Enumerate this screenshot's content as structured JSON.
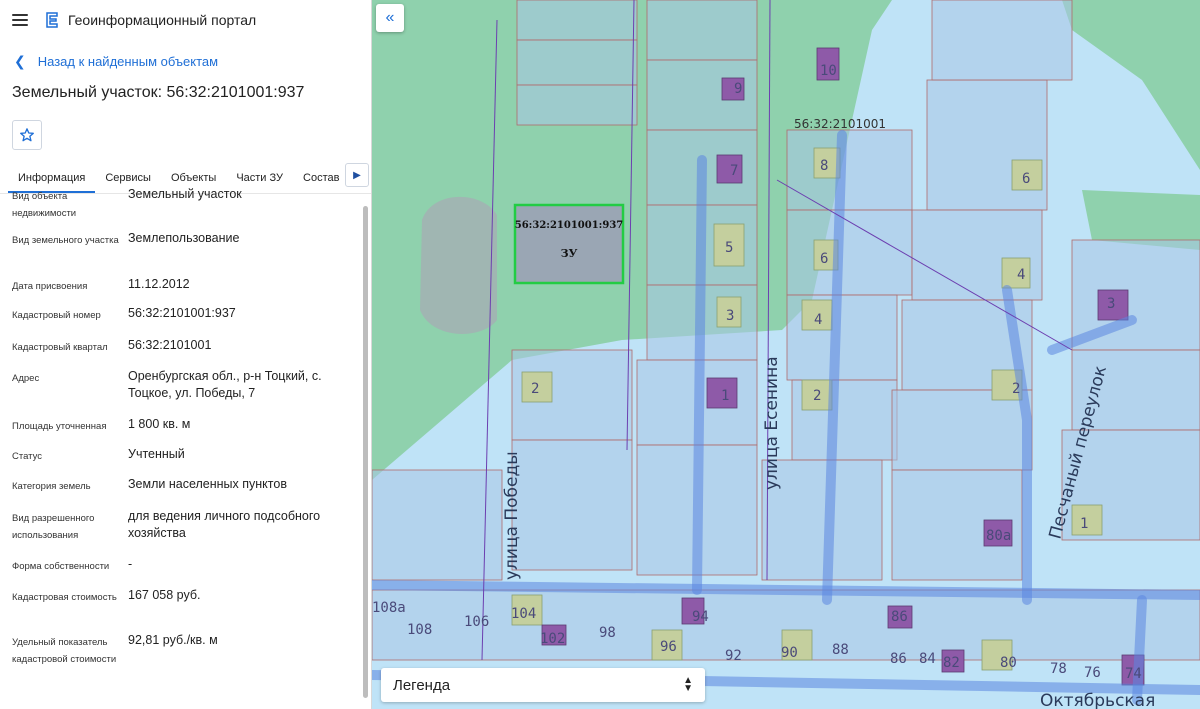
{
  "app": {
    "title": "Геоинформационный портал"
  },
  "nav": {
    "back_label": "Назад к найденным объектам"
  },
  "object": {
    "title": "Земельный участок: 56:32:2101001:937"
  },
  "tabs": [
    {
      "label": "Информация",
      "active": true
    },
    {
      "label": "Сервисы",
      "active": false
    },
    {
      "label": "Объекты",
      "active": false
    },
    {
      "label": "Части ЗУ",
      "active": false
    },
    {
      "label": "Состав",
      "active": false
    }
  ],
  "properties": [
    {
      "label": "Вид объекта недвижимости",
      "value": "Земельный участок"
    },
    {
      "label": "Вид земельного участка",
      "value": "Землепользование"
    },
    {
      "label": "Дата присвоения",
      "value": "11.12.2012"
    },
    {
      "label": "Кадастровый номер",
      "value": "56:32:2101001:937"
    },
    {
      "label": "Кадастровый квартал",
      "value": "56:32:2101001"
    },
    {
      "label": "Адрес",
      "value": "Оренбургская обл., р-н Тоцкий, с. Тоцкое, ул. Победы, 7"
    },
    {
      "label": "Площадь уточненная",
      "value": "1 800 кв. м"
    },
    {
      "label": "Статус",
      "value": "Учтенный"
    },
    {
      "label": "Категория земель",
      "value": "Земли населенных пунктов"
    },
    {
      "label": "Вид разрешенного использования",
      "value": "для ведения личного подсобного хозяйства"
    },
    {
      "label": "Форма собственности",
      "value": "-"
    },
    {
      "label": "Кадастровая стоимость",
      "value": "167 058 руб."
    },
    {
      "label": "Удельный показатель кадастровой стоимости",
      "value": "92,81 руб./кв. м"
    }
  ],
  "map": {
    "selected_parcel": {
      "number": "56:32:2101001:937",
      "tag": "ЗУ"
    },
    "quarter_label": "56:32:2101001",
    "streets": [
      {
        "name": "улица Победы"
      },
      {
        "name": "улица Есенина"
      },
      {
        "name": "Песчаный переулок"
      },
      {
        "name": "Октябрьская"
      }
    ],
    "house_numbers": [
      "10",
      "9",
      "7",
      "8",
      "6",
      "5",
      "6",
      "4",
      "3",
      "3",
      "4",
      "2",
      "1",
      "2",
      "2",
      "1",
      "80а",
      "108а",
      "108",
      "106",
      "104",
      "102",
      "98",
      "94",
      "96",
      "92",
      "90",
      "88",
      "86",
      "86",
      "84",
      "82",
      "80",
      "78",
      "76",
      "74",
      "2"
    ],
    "legend_label": "Легенда",
    "colors": {
      "forest": "#8fd1ad",
      "town": "#bfe3f7",
      "parcel_fill": "#a9c6e6",
      "parcel_line": "#b06b6b",
      "building": "#c4cf9e",
      "building_purple": "#8e5aa8",
      "road": "#5b86e0",
      "selection": "#22cc44",
      "selected_fill": "#9aa6b4"
    }
  }
}
